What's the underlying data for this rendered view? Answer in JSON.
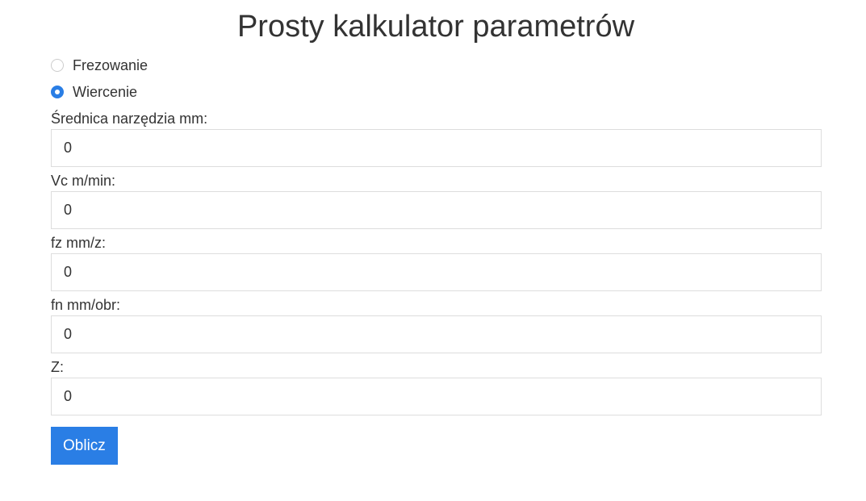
{
  "page": {
    "title": "Prosty kalkulator parametrów"
  },
  "mode": {
    "options": [
      {
        "label": "Frezowanie",
        "checked": false
      },
      {
        "label": "Wiercenie",
        "checked": true
      }
    ]
  },
  "fields": [
    {
      "label": "Średnica narzędzia mm:",
      "value": "0"
    },
    {
      "label": "Vc m/min:",
      "value": "0"
    },
    {
      "label": "fz mm/z:",
      "value": "0"
    },
    {
      "label": "fn mm/obr:",
      "value": "0"
    },
    {
      "label": "Z:",
      "value": "0"
    }
  ],
  "actions": {
    "submit_label": "Oblicz"
  },
  "colors": {
    "accent": "#2a7ee5",
    "text": "#333333",
    "border": "#dddddd"
  }
}
